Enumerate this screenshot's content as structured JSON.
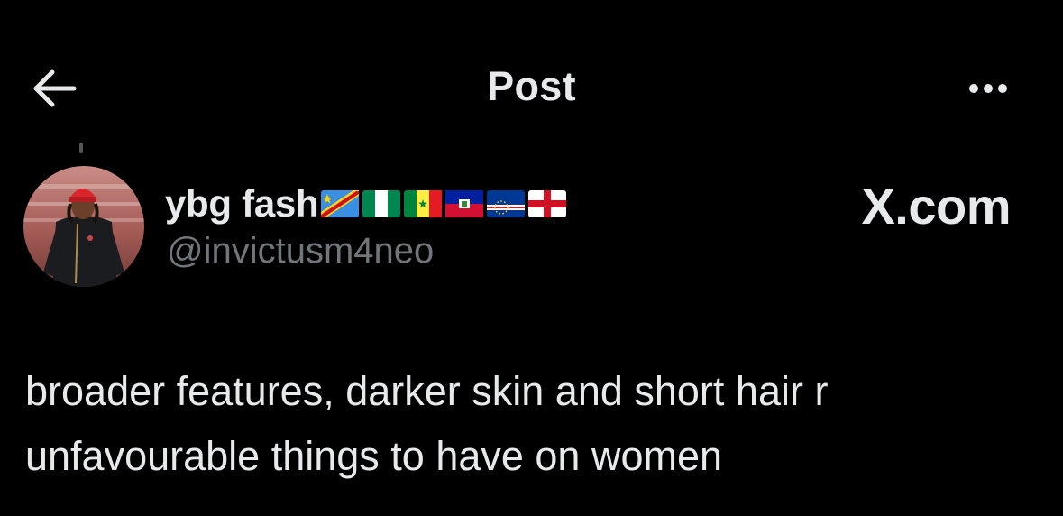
{
  "header": {
    "back_icon": "arrow-left-icon",
    "title": "Post",
    "more_icon": "more-horizontal-icon"
  },
  "author": {
    "display_name": "ybg fash",
    "flags": [
      "DR Congo",
      "Nigeria",
      "Senegal",
      "Haiti",
      "Cape Verde",
      "England"
    ],
    "handle": "@invictusm4neo",
    "avatar_icon": "profile-photo"
  },
  "brand": {
    "text": "X.com"
  },
  "post": {
    "line1": "broader features, darker skin and short hair r",
    "line2": "unfavourable things to have on women"
  },
  "colors": {
    "background": "#000000",
    "primary_text": "#e7e9ea",
    "secondary_text": "#71767b"
  }
}
